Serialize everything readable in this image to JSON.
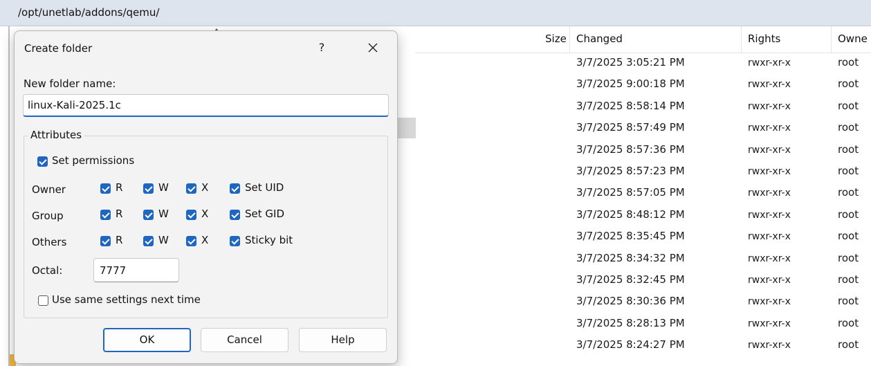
{
  "path": "/opt/unetlab/addons/qemu/",
  "file_list": {
    "columns": {
      "size": "Size",
      "changed": "Changed",
      "rights": "Rights",
      "owner": "Owne"
    },
    "rows": [
      {
        "changed": "3/7/2025 3:05:21 PM",
        "rights": "rwxr-xr-x",
        "owner": "root"
      },
      {
        "changed": "3/7/2025 9:00:18 PM",
        "rights": "rwxr-xr-x",
        "owner": "root"
      },
      {
        "changed": "3/7/2025 8:58:14 PM",
        "rights": "rwxr-xr-x",
        "owner": "root"
      },
      {
        "changed": "3/7/2025 8:57:49 PM",
        "rights": "rwxr-xr-x",
        "owner": "root"
      },
      {
        "changed": "3/7/2025 8:57:36 PM",
        "rights": "rwxr-xr-x",
        "owner": "root"
      },
      {
        "changed": "3/7/2025 8:57:23 PM",
        "rights": "rwxr-xr-x",
        "owner": "root"
      },
      {
        "changed": "3/7/2025 8:57:05 PM",
        "rights": "rwxr-xr-x",
        "owner": "root"
      },
      {
        "changed": "3/7/2025 8:48:12 PM",
        "rights": "rwxr-xr-x",
        "owner": "root"
      },
      {
        "changed": "3/7/2025 8:35:45 PM",
        "rights": "rwxr-xr-x",
        "owner": "root"
      },
      {
        "changed": "3/7/2025 8:34:32 PM",
        "rights": "rwxr-xr-x",
        "owner": "root"
      },
      {
        "changed": "3/7/2025 8:32:45 PM",
        "rights": "rwxr-xr-x",
        "owner": "root"
      },
      {
        "changed": "3/7/2025 8:30:36 PM",
        "rights": "rwxr-xr-x",
        "owner": "root"
      },
      {
        "changed": "3/7/2025 8:28:13 PM",
        "rights": "rwxr-xr-x",
        "owner": "root"
      },
      {
        "changed": "3/7/2025 8:24:27 PM",
        "rights": "rwxr-xr-x",
        "owner": "root"
      }
    ]
  },
  "dialog": {
    "title": "Create folder",
    "help_glyph": "?",
    "new_folder_label": "New folder name:",
    "folder_name_value": "linux-Kali-2025.1c",
    "attributes_label": "Attributes",
    "set_permissions_label": "Set permissions",
    "set_permissions_checked": true,
    "permissions": [
      {
        "label": "Owner",
        "r": "R",
        "w": "W",
        "x": "X",
        "special": "Set UID",
        "checked": [
          true,
          true,
          true,
          true
        ]
      },
      {
        "label": "Group",
        "r": "R",
        "w": "W",
        "x": "X",
        "special": "Set GID",
        "checked": [
          true,
          true,
          true,
          true
        ]
      },
      {
        "label": "Others",
        "r": "R",
        "w": "W",
        "x": "X",
        "special": "Sticky bit",
        "checked": [
          true,
          true,
          true,
          true
        ]
      }
    ],
    "octal_label": "Octal:",
    "octal_value": "7777",
    "same_settings_label": "Use same settings next time",
    "same_settings_checked": false,
    "buttons": {
      "ok": "OK",
      "cancel": "Cancel",
      "help": "Help"
    }
  },
  "colors": {
    "accent": "#1f66c1",
    "pathbar_bg": "#dde4ee",
    "dialog_bg": "#f3f3f3"
  }
}
